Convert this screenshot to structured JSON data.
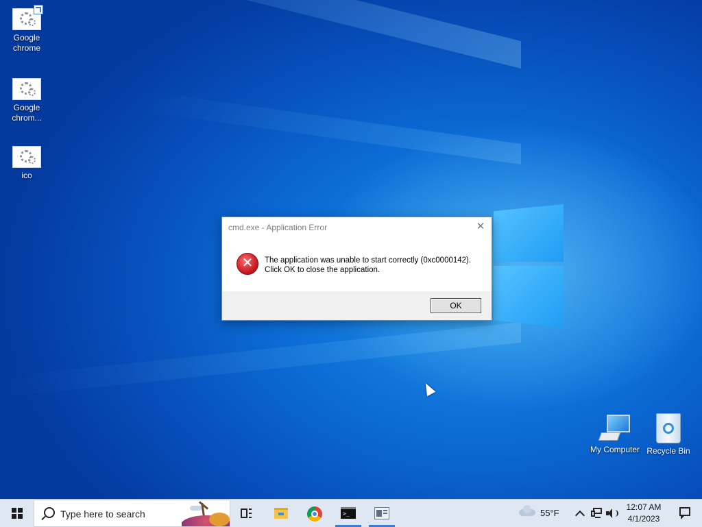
{
  "desktop": {
    "icons": [
      {
        "label": "Google chrome"
      },
      {
        "label": "Google chrom..."
      },
      {
        "label": "ico"
      },
      {
        "label": "My Computer"
      },
      {
        "label": "Recycle Bin"
      }
    ]
  },
  "dialog": {
    "title": "cmd.exe - Application Error",
    "message_line1": "The application was unable to start correctly (0xc0000142).",
    "message_line2": "Click OK to close the application.",
    "ok_label": "OK",
    "close_glyph": "✕",
    "icon": "error-icon"
  },
  "taskbar": {
    "search_placeholder": "Type here to search",
    "weather": {
      "temperature": "55°F",
      "icon": "cloud-icon"
    },
    "clock": {
      "time": "12:07 AM",
      "date": "4/1/2023"
    },
    "apps": [
      "task-view-icon",
      "file-explorer-icon",
      "chrome-icon",
      "cmd-icon",
      "app-window-icon"
    ],
    "active_apps": [
      "cmd-icon",
      "app-window-icon"
    ]
  },
  "colors": {
    "accent": "#3a7bd5",
    "error_red": "#c0121b"
  }
}
